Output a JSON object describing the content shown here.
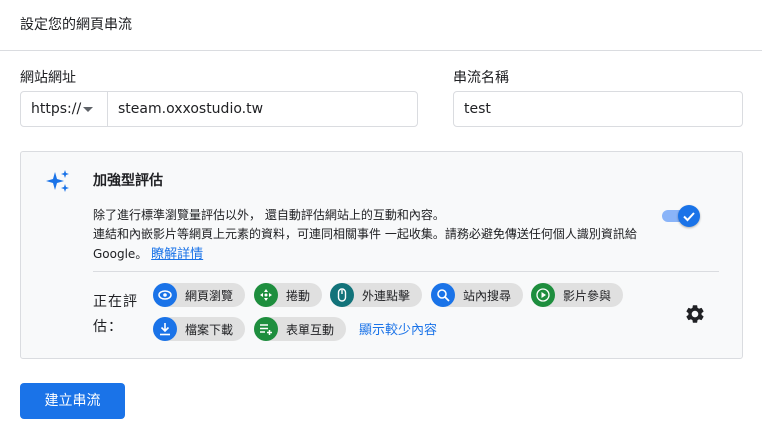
{
  "header": {
    "title": "設定您的網頁串流"
  },
  "form": {
    "url_label": "網站網址",
    "protocol": "https://",
    "url_value": "steam.oxxostudio.tw",
    "name_label": "串流名稱",
    "name_value": "test"
  },
  "enhanced": {
    "title": "加強型評估",
    "desc_line1": "除了進行標準瀏覽量評估以外， 還自動評估網站上的互動和內容。",
    "desc_line2": "連結和內嵌影片等網頁上元素的資料，可連同相關事件 一起收集。請務必避免傳送任何個人識別資訊給 Google。",
    "learn_more": "瞭解詳情",
    "toggle_on": true,
    "measuring_label": "正在評估：",
    "chips": [
      {
        "label": "網頁瀏覽",
        "icon": "eye-icon"
      },
      {
        "label": "捲動",
        "icon": "scroll-icon"
      },
      {
        "label": "外連點擊",
        "icon": "mouse-icon"
      },
      {
        "label": "站內搜尋",
        "icon": "search-icon"
      },
      {
        "label": "影片參與",
        "icon": "play-icon"
      },
      {
        "label": "檔案下載",
        "icon": "download-icon"
      },
      {
        "label": "表單互動",
        "icon": "form-icon"
      }
    ],
    "show_less": "顯示較少內容"
  },
  "actions": {
    "create_label": "建立串流"
  },
  "colors": {
    "accent": "#1a73e8",
    "green": "#1e8e3e",
    "teal": "#12737a",
    "chip_bg": "#e0e0e0"
  }
}
